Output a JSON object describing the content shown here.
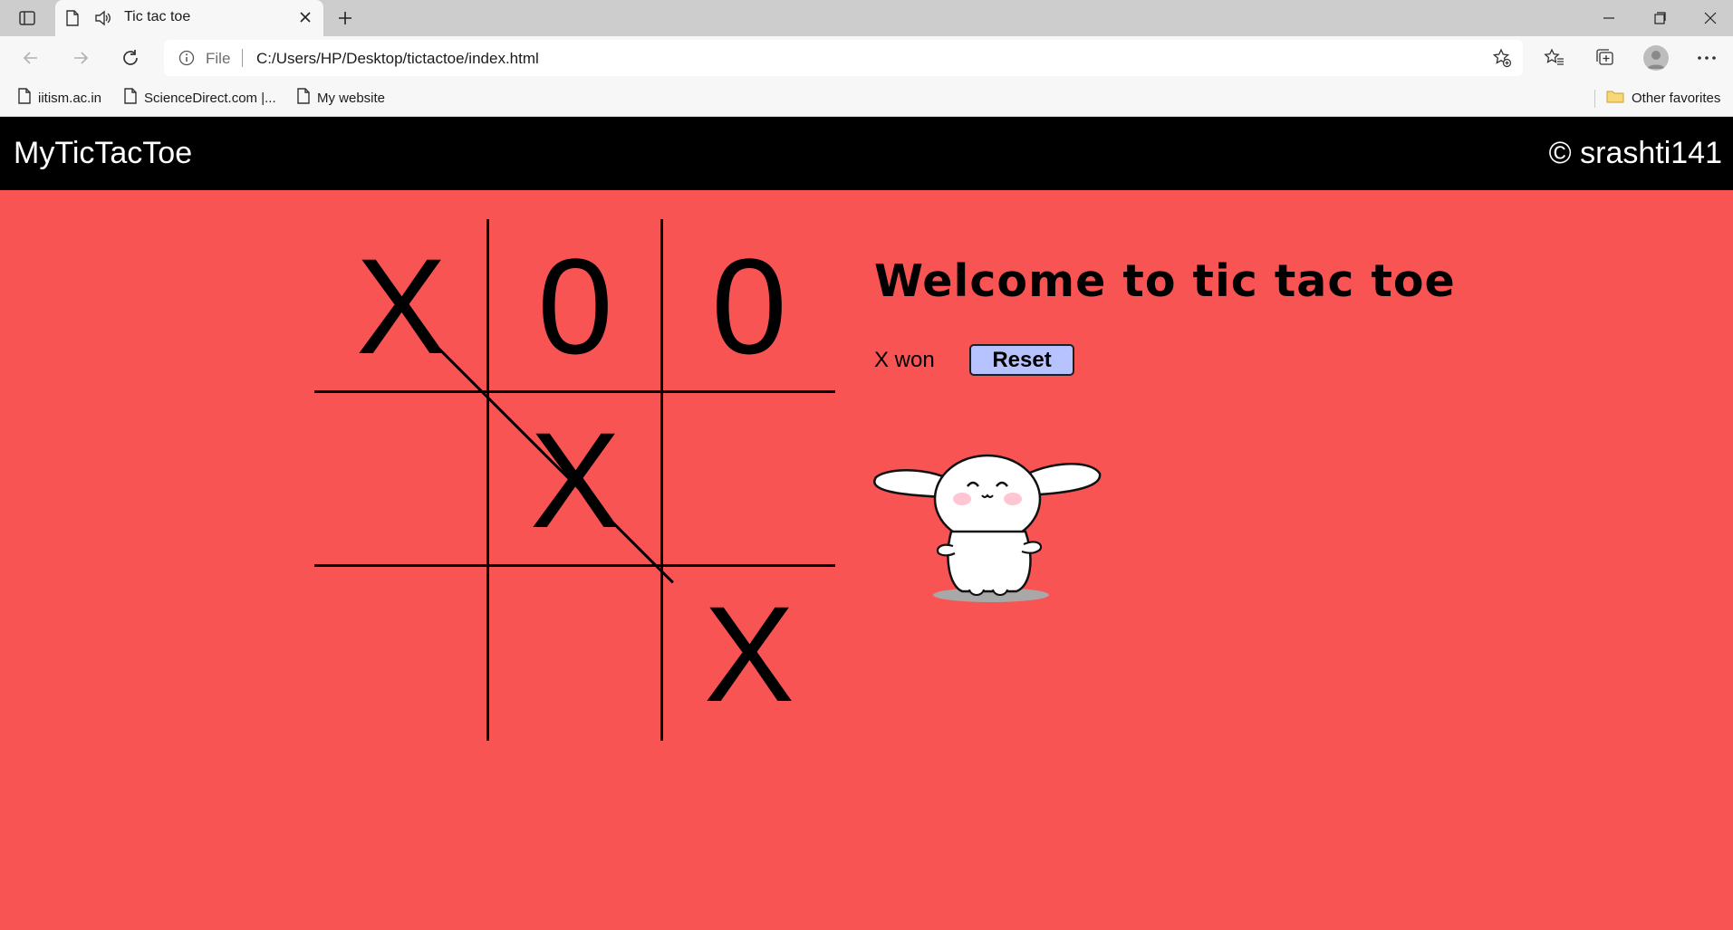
{
  "browser": {
    "tab_title": "Tic tac toe",
    "address": {
      "scheme": "File",
      "url": "C:/Users/HP/Desktop/tictactoe/index.html"
    },
    "bookmarks": [
      {
        "label": "iitism.ac.in",
        "icon": "page-icon"
      },
      {
        "label": "ScienceDirect.com |...",
        "icon": "page-icon"
      },
      {
        "label": "My website",
        "icon": "page-icon"
      }
    ],
    "other_favorites": "Other favorites"
  },
  "page": {
    "brand": "MyTicTacToe",
    "copyright": "© srashti141",
    "colors": {
      "background": "#f85454",
      "navbar": "#000000",
      "reset_button": "#b7c3ff"
    },
    "board": {
      "cells": [
        "X",
        "0",
        "0",
        "",
        "X",
        "",
        "",
        "",
        "X"
      ],
      "winning_line": "diagonal top-left to bottom-right"
    },
    "info": {
      "heading": "Welcome to tic tac toe",
      "status": "X won",
      "reset_label": "Reset",
      "celebration_image": "happy-bunny-image"
    }
  }
}
